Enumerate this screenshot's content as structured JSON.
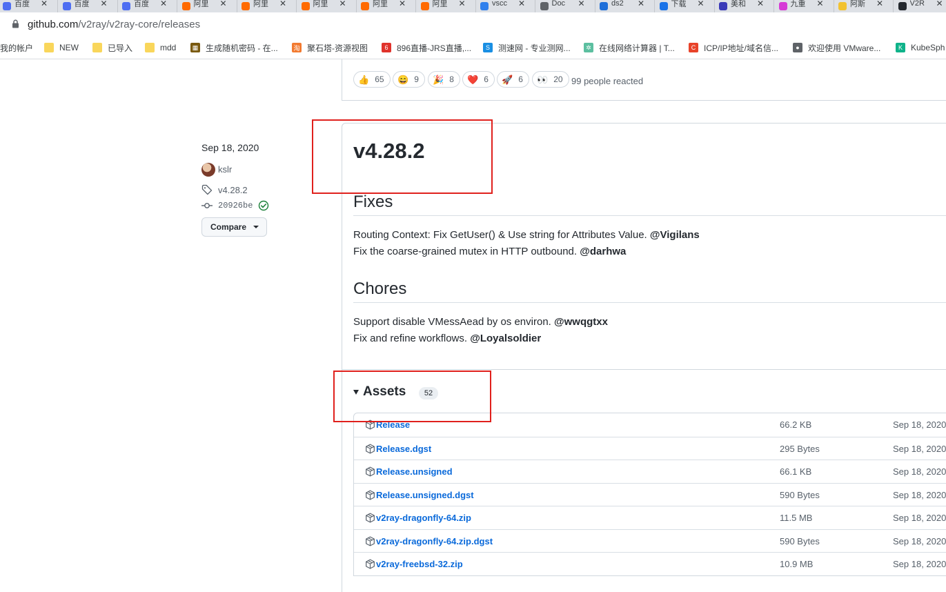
{
  "browser": {
    "tabs": [
      {
        "label": "百度",
        "fav_color": "#4e6ef2",
        "fav_glyph": "∞"
      },
      {
        "label": "百度",
        "fav_color": "#4e6ef2",
        "fav_glyph": "∞"
      },
      {
        "label": "百度",
        "fav_color": "#4e6ef2",
        "fav_glyph": "∞"
      },
      {
        "label": "阿里",
        "fav_color": "#ff6a00",
        "fav_glyph": "[-]"
      },
      {
        "label": "阿里",
        "fav_color": "#ff6a00",
        "fav_glyph": "[-]"
      },
      {
        "label": "阿里",
        "fav_color": "#ff6a00",
        "fav_glyph": "[-]"
      },
      {
        "label": "阿里",
        "fav_color": "#ff6a00",
        "fav_glyph": "[-]"
      },
      {
        "label": "阿里",
        "fav_color": "#ff6a00",
        "fav_glyph": "[-]"
      },
      {
        "label": "vscc",
        "fav_color": "#2f80ed",
        "fav_glyph": "✈"
      },
      {
        "label": "Doc",
        "fav_color": "#5f6368",
        "fav_glyph": "●"
      },
      {
        "label": "ds2",
        "fav_color": "#1e6fd9",
        "fav_glyph": "CSDN"
      },
      {
        "label": "下载",
        "fav_color": "#1a73e8",
        "fav_glyph": "↓"
      },
      {
        "label": "美和",
        "fav_color": "#3a3ab8",
        "fav_glyph": "✿"
      },
      {
        "label": "九重",
        "fav_color": "#d63ad6",
        "fav_glyph": "▶"
      },
      {
        "label": "阿斯",
        "fav_color": "#f2c230",
        "fav_glyph": "●"
      },
      {
        "label": "V2R",
        "fav_color": "#24292f",
        "fav_glyph": "●"
      }
    ],
    "url_host": "github.com",
    "url_path": "/v2ray/v2ray-core/releases",
    "bookmarks": [
      {
        "label": "我的帐户",
        "type": "text"
      },
      {
        "label": "NEW",
        "type": "folder"
      },
      {
        "label": "已导入",
        "type": "folder"
      },
      {
        "label": "mdd",
        "type": "folder"
      },
      {
        "label": "生成随机密码 - 在...",
        "type": "icon",
        "color": "#7a5a10",
        "glyph": "▦"
      },
      {
        "label": "聚石塔-资源视图",
        "type": "icon",
        "color": "#f27a30",
        "glyph": "淘"
      },
      {
        "label": "896直播-JRS直播,...",
        "type": "icon",
        "color": "#e0332c",
        "glyph": "6"
      },
      {
        "label": "测速网 - 专业测网...",
        "type": "icon",
        "color": "#1a8fe3",
        "glyph": "S"
      },
      {
        "label": "在线网络计算器 | T...",
        "type": "icon",
        "color": "#5cbfa0",
        "glyph": "✲"
      },
      {
        "label": "ICP/IP地址/域名信...",
        "type": "icon",
        "color": "#e8432a",
        "glyph": "C"
      },
      {
        "label": "欢迎使用 VMware...",
        "type": "icon",
        "color": "#5f6368",
        "glyph": "●"
      },
      {
        "label": "KubeSph",
        "type": "icon",
        "color": "#0fb38a",
        "glyph": "K"
      }
    ]
  },
  "reactions": {
    "items": [
      {
        "emoji": "👍",
        "count": "65"
      },
      {
        "emoji": "😄",
        "count": "9"
      },
      {
        "emoji": "🎉",
        "count": "8"
      },
      {
        "emoji": "❤️",
        "count": "6"
      },
      {
        "emoji": "🚀",
        "count": "6"
      },
      {
        "emoji": "👀",
        "count": "20"
      }
    ],
    "summary": "99 people reacted"
  },
  "release": {
    "date": "Sep 18, 2020",
    "author": "kslr",
    "tag": "v4.28.2",
    "commit": "20926be",
    "compare_label": "Compare",
    "title": "v4.28.2",
    "fixes_heading": "Fixes",
    "fix_lines": [
      {
        "text": "Routing Context: Fix GetUser() & Use string for Attributes Value. ",
        "mention": "@Vigilans"
      },
      {
        "text": "Fix the coarse-grained mutex in HTTP outbound. ",
        "mention": "@darhwa"
      }
    ],
    "chores_heading": "Chores",
    "chore_lines": [
      {
        "text": "Support disable VMessAead by os environ. ",
        "mention": "@wwqgtxx"
      },
      {
        "text": "Fix and refine workflows. ",
        "mention": "@Loyalsoldier"
      }
    ]
  },
  "assets": {
    "heading": "Assets",
    "count": "52",
    "rows": [
      {
        "name": "Release",
        "size": "66.2 KB",
        "date": "Sep 18, 2020"
      },
      {
        "name": "Release.dgst",
        "size": "295 Bytes",
        "date": "Sep 18, 2020"
      },
      {
        "name": "Release.unsigned",
        "size": "66.1 KB",
        "date": "Sep 18, 2020"
      },
      {
        "name": "Release.unsigned.dgst",
        "size": "590 Bytes",
        "date": "Sep 18, 2020"
      },
      {
        "name": "v2ray-dragonfly-64.zip",
        "size": "11.5 MB",
        "date": "Sep 18, 2020"
      },
      {
        "name": "v2ray-dragonfly-64.zip.dgst",
        "size": "590 Bytes",
        "date": "Sep 18, 2020"
      },
      {
        "name": "v2ray-freebsd-32.zip",
        "size": "10.9 MB",
        "date": "Sep 18, 2020"
      }
    ]
  },
  "colors": {
    "link": "#0969da",
    "annotation": "#e0201c",
    "check": "#1a7f37"
  }
}
